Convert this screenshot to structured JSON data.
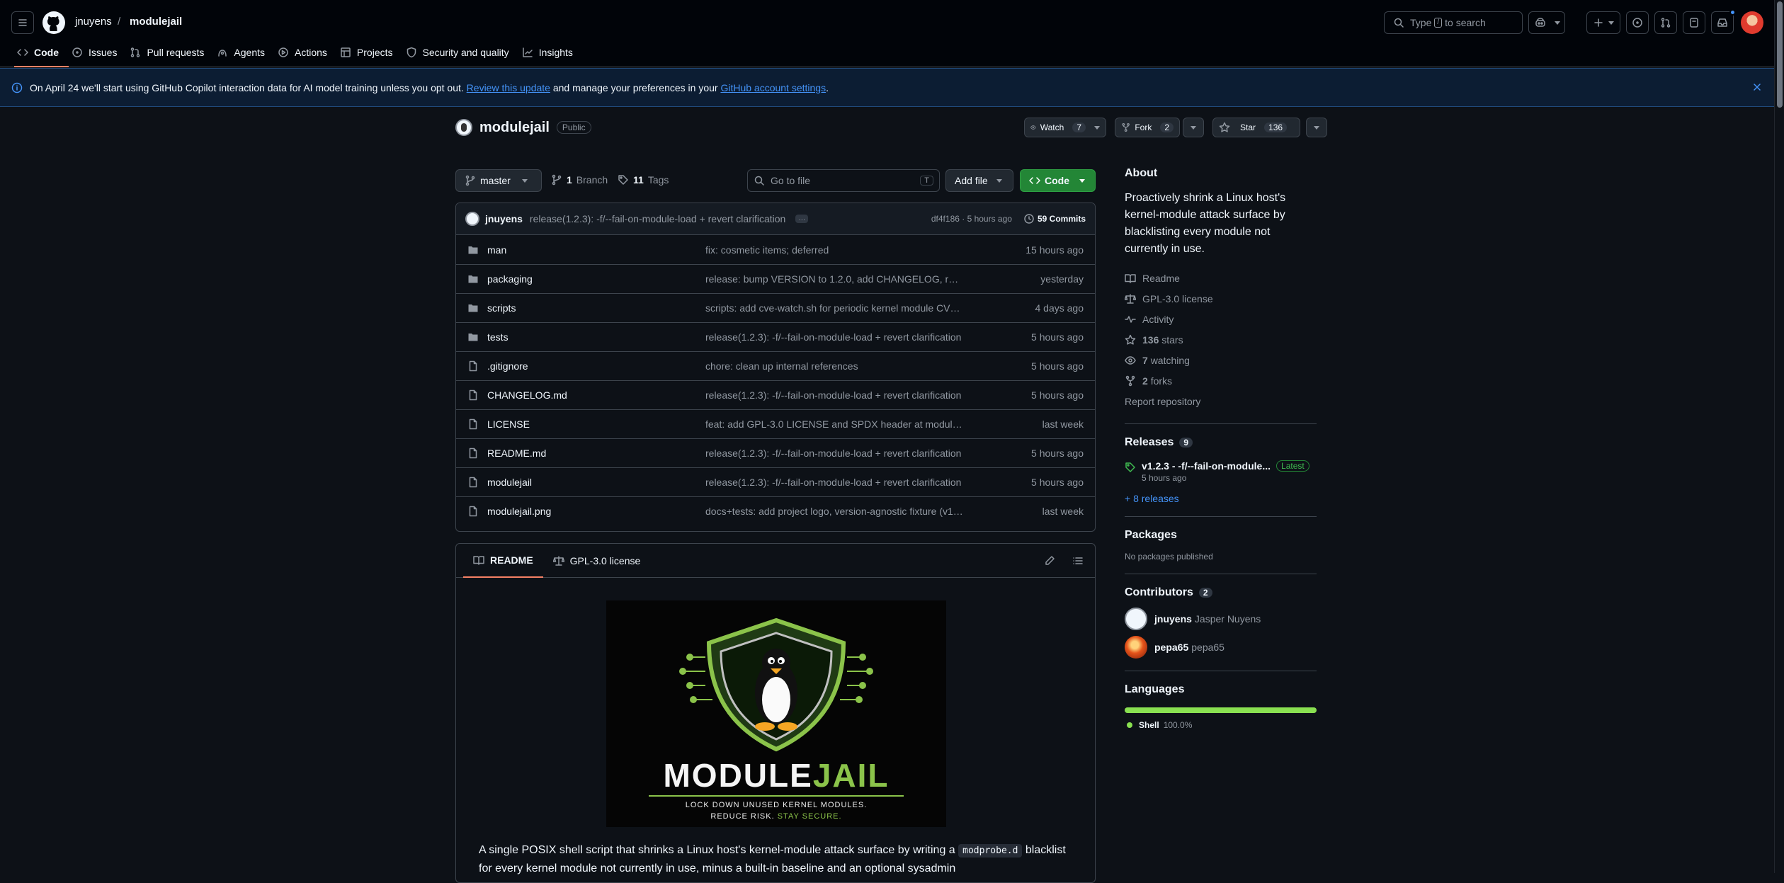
{
  "header": {
    "owner": "jnuyens",
    "separator": "/",
    "repo": "modulejail",
    "search_prefix": "Type",
    "search_key": "/",
    "search_suffix": "to search",
    "icons": [
      "hamburger-icon",
      "github-logo-icon",
      "copilot-icon",
      "plus-icon",
      "issue-icon",
      "pull-request-icon",
      "agent-icon",
      "inbox-icon",
      "avatar"
    ]
  },
  "nav": [
    {
      "label": "Code",
      "icon": "code-icon",
      "active": true
    },
    {
      "label": "Issues",
      "icon": "issue-icon"
    },
    {
      "label": "Pull requests",
      "icon": "pull-request-icon"
    },
    {
      "label": "Agents",
      "icon": "agent-icon"
    },
    {
      "label": "Actions",
      "icon": "play-icon"
    },
    {
      "label": "Projects",
      "icon": "table-icon"
    },
    {
      "label": "Security and quality",
      "icon": "shield-icon"
    },
    {
      "label": "Insights",
      "icon": "graph-icon"
    }
  ],
  "banner": {
    "text1": "On April 24 we'll start using GitHub Copilot interaction data for AI model training unless you opt out.",
    "link1": "Review this update",
    "text2": "and manage your preferences in your",
    "link2": "GitHub account settings",
    "text3": "."
  },
  "repo": {
    "name": "modulejail",
    "visibility": "Public",
    "watch_label": "Watch",
    "watch_count": "7",
    "fork_label": "Fork",
    "fork_count": "2",
    "star_label": "Star",
    "star_count": "136"
  },
  "toolbar": {
    "branch": "master",
    "branch_count": "1",
    "branch_label": "Branch",
    "tag_count": "11",
    "tag_label": "Tags",
    "goto_placeholder": "Go to file",
    "goto_key": "T",
    "add_file": "Add file",
    "code": "Code"
  },
  "commit": {
    "author": "jnuyens",
    "message": "release(1.2.3): -f/--fail-on-module-load + revert clarification",
    "sha_time": "df4f186 · 5 hours ago",
    "commits": "59 Commits"
  },
  "files": [
    {
      "name": "man",
      "type": "dir",
      "msg": "fix: cosmetic items; deferred",
      "date": "15 hours ago"
    },
    {
      "name": "packaging",
      "type": "dir",
      "msg": "release: bump VERSION to 1.2.0, add CHANGELOG, refres...",
      "date": "yesterday"
    },
    {
      "name": "scripts",
      "type": "dir",
      "msg": "scripts: add cve-watch.sh for periodic kernel module CVE ...",
      "date": "4 days ago"
    },
    {
      "name": "tests",
      "type": "dir",
      "msg": "release(1.2.3): -f/--fail-on-module-load + revert clarification",
      "date": "5 hours ago"
    },
    {
      "name": ".gitignore",
      "type": "file",
      "msg": "chore: clean up internal references",
      "date": "5 hours ago"
    },
    {
      "name": "CHANGELOG.md",
      "type": "file",
      "msg": "release(1.2.3): -f/--fail-on-module-load + revert clarification",
      "date": "5 hours ago"
    },
    {
      "name": "LICENSE",
      "type": "file",
      "msg": "feat: add GPL-3.0 LICENSE and SPDX header at modulejail...",
      "date": "last week"
    },
    {
      "name": "README.md",
      "type": "file",
      "msg": "release(1.2.3): -f/--fail-on-module-load + revert clarification",
      "date": "5 hours ago"
    },
    {
      "name": "modulejail",
      "type": "file",
      "msg": "release(1.2.3): -f/--fail-on-module-load + revert clarification",
      "date": "5 hours ago"
    },
    {
      "name": "modulejail.png",
      "type": "file",
      "msg": "docs+tests: add project logo, version-agnostic fixture (v1....",
      "date": "last week"
    }
  ],
  "readme": {
    "tab_readme": "README",
    "tab_license": "GPL-3.0 license",
    "logo_word1": "MODULE",
    "logo_word2": "JAIL",
    "logo_tag1": "LOCK DOWN UNUSED KERNEL MODULES.",
    "logo_tag2a": "REDUCE RISK.",
    "logo_tag2b": "STAY SECURE.",
    "para1_a": "A single POSIX shell script that shrinks a Linux host's kernel-module attack surface by writing a",
    "para1_code": "modprobe.d",
    "para1_b": "blacklist for every kernel module not currently in use, minus a built-in baseline and an optional sysadmin"
  },
  "about": {
    "title": "About",
    "description": "Proactively shrink a Linux host's kernel-module attack surface by blacklisting every module not currently in use.",
    "readme": "Readme",
    "license": "GPL-3.0 license",
    "activity": "Activity",
    "stars_count": "136",
    "stars_label": "stars",
    "watching_count": "7",
    "watching_label": "watching",
    "forks_count": "2",
    "forks_label": "forks",
    "report": "Report repository"
  },
  "releases": {
    "title": "Releases",
    "count": "9",
    "latest_name": "v1.2.3 - -f/--fail-on-module...",
    "latest_badge": "Latest",
    "latest_time": "5 hours ago",
    "more": "+ 8 releases"
  },
  "packages": {
    "title": "Packages",
    "empty": "No packages published"
  },
  "contributors": {
    "title": "Contributors",
    "count": "2",
    "items": [
      {
        "login": "jnuyens",
        "name": "Jasper Nuyens"
      },
      {
        "login": "pepa65",
        "name": "pepa65"
      }
    ]
  },
  "languages": {
    "title": "Languages",
    "items": [
      {
        "name": "Shell",
        "percent": "100.0%",
        "share": 1.0,
        "color": "#89e051"
      }
    ]
  },
  "colors": {
    "accent": "#4493f8",
    "primary_button": "#238636",
    "tab_underline": "#f78166",
    "banner_bg": "#0c1d33"
  }
}
